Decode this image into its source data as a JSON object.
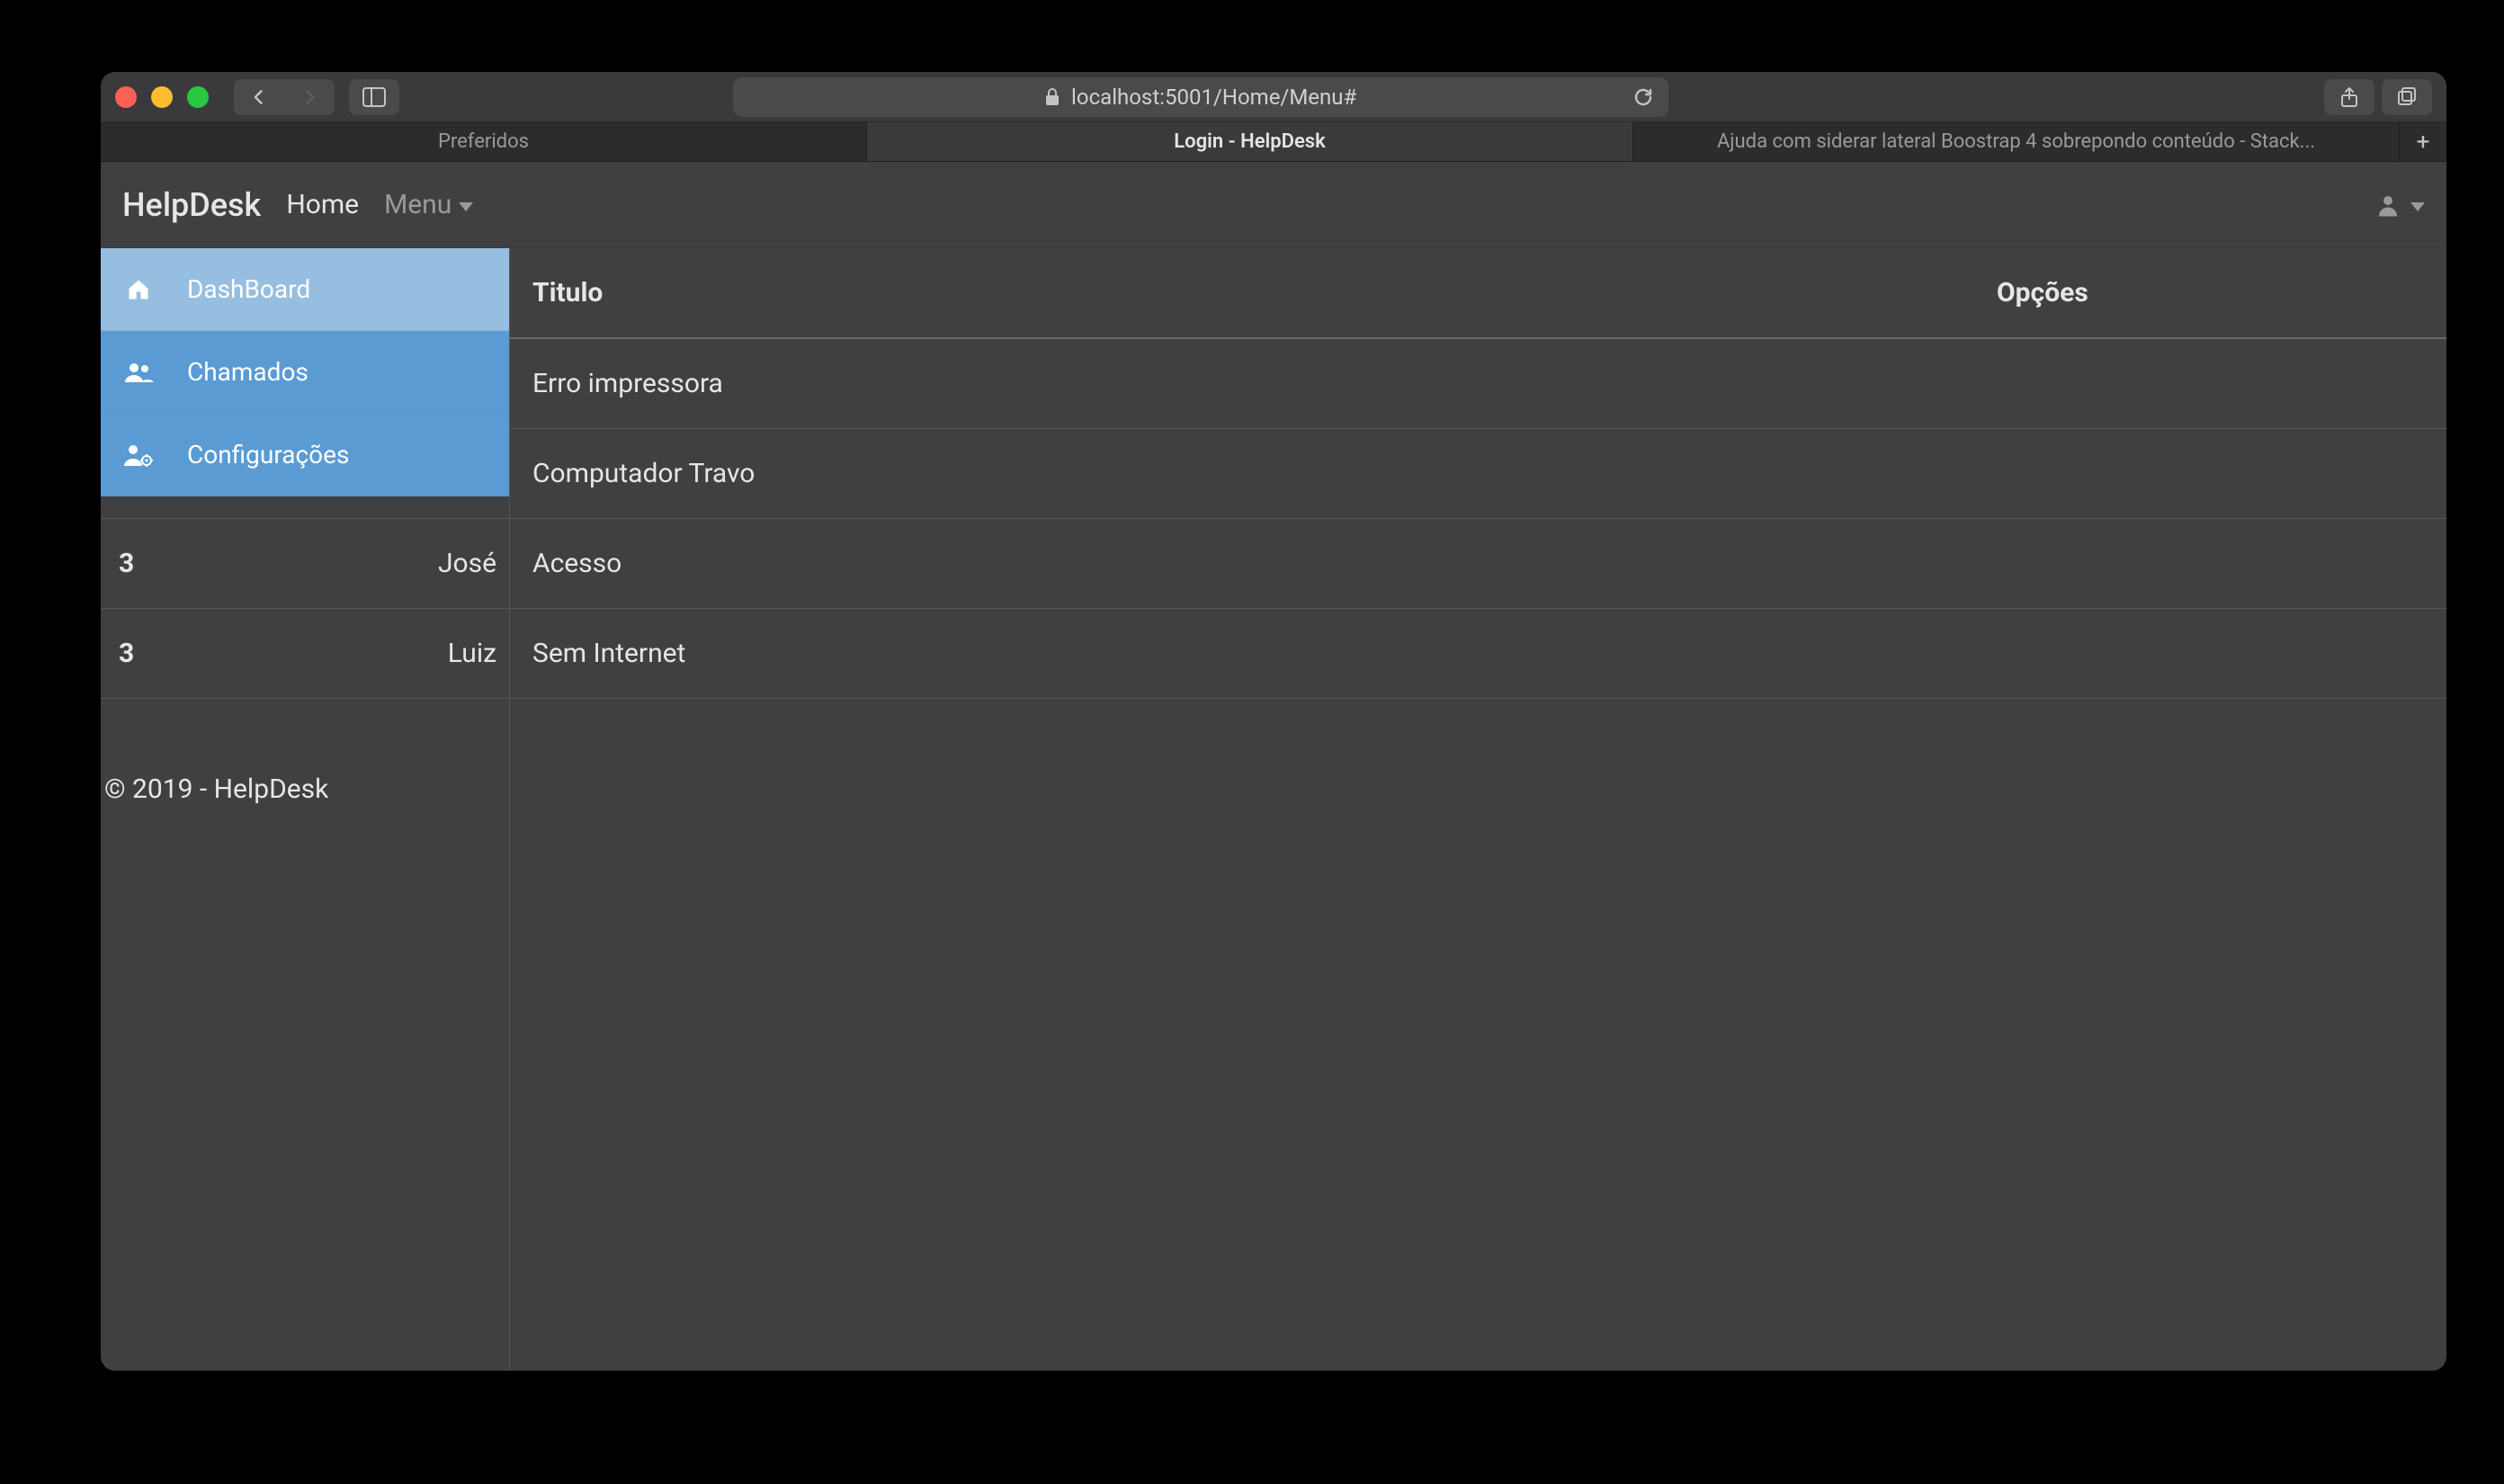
{
  "browser": {
    "url": "localhost:5001/Home/Menu#",
    "tabs": [
      {
        "label": "Preferidos",
        "active": false
      },
      {
        "label": "Login - HelpDesk",
        "active": true
      },
      {
        "label": "Ajuda com siderar lateral Boostrap 4 sobrepondo conteúdo - Stack...",
        "active": false
      }
    ]
  },
  "navbar": {
    "brand": "HelpDesk",
    "links": [
      {
        "label": "Home"
      },
      {
        "label": "Menu"
      }
    ]
  },
  "sidebar": {
    "items": [
      {
        "label": "DashBoard",
        "icon": "home-icon"
      },
      {
        "label": "Chamados",
        "icon": "users-icon"
      },
      {
        "label": "Configurações",
        "icon": "user-cog-icon"
      }
    ]
  },
  "table": {
    "headers": {
      "id": "",
      "name": "",
      "title": "Titulo",
      "options": "Opções"
    },
    "rows": [
      {
        "id": "",
        "name": "",
        "title": "Erro impressora"
      },
      {
        "id": "",
        "name": "",
        "title": "Computador Travo"
      },
      {
        "id": "3",
        "name": "José",
        "title": "Acesso"
      },
      {
        "id": "3",
        "name": "Luiz",
        "title": "Sem Internet"
      }
    ]
  },
  "footer": "© 2019 - HelpDesk"
}
